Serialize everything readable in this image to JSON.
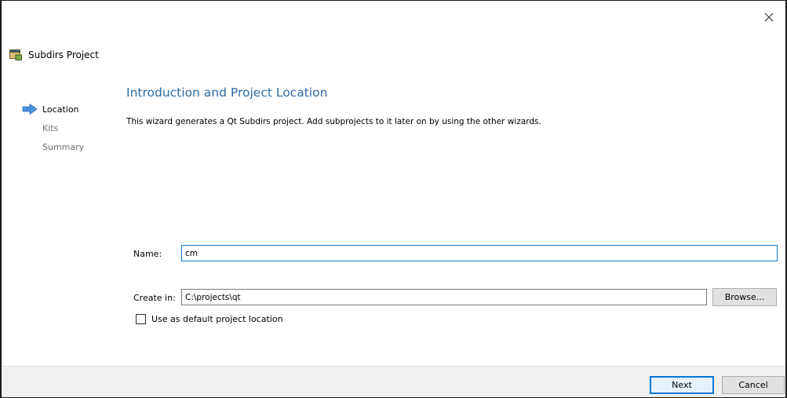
{
  "window": {
    "title": "Subdirs Project"
  },
  "steps": [
    {
      "label": "Location",
      "current": true
    },
    {
      "label": "Kits",
      "current": false
    },
    {
      "label": "Summary",
      "current": false
    }
  ],
  "page": {
    "title": "Introduction and Project Location",
    "description": "This wizard generates a Qt Subdirs project. Add subprojects to it later on by using the other wizards."
  },
  "form": {
    "name_label": "Name:",
    "name_value": "cm",
    "create_in_label": "Create in:",
    "create_in_value": "C:\\projects\\qt",
    "browse_label": "Browse...",
    "default_location_label": "Use as default project location",
    "default_location_checked": false
  },
  "footer": {
    "next_label": "Next",
    "cancel_label": "Cancel"
  },
  "colors": {
    "title_blue": "#2e6da4",
    "focus_blue": "#0a78d7",
    "arrow_blue": "#4a8fe0"
  }
}
